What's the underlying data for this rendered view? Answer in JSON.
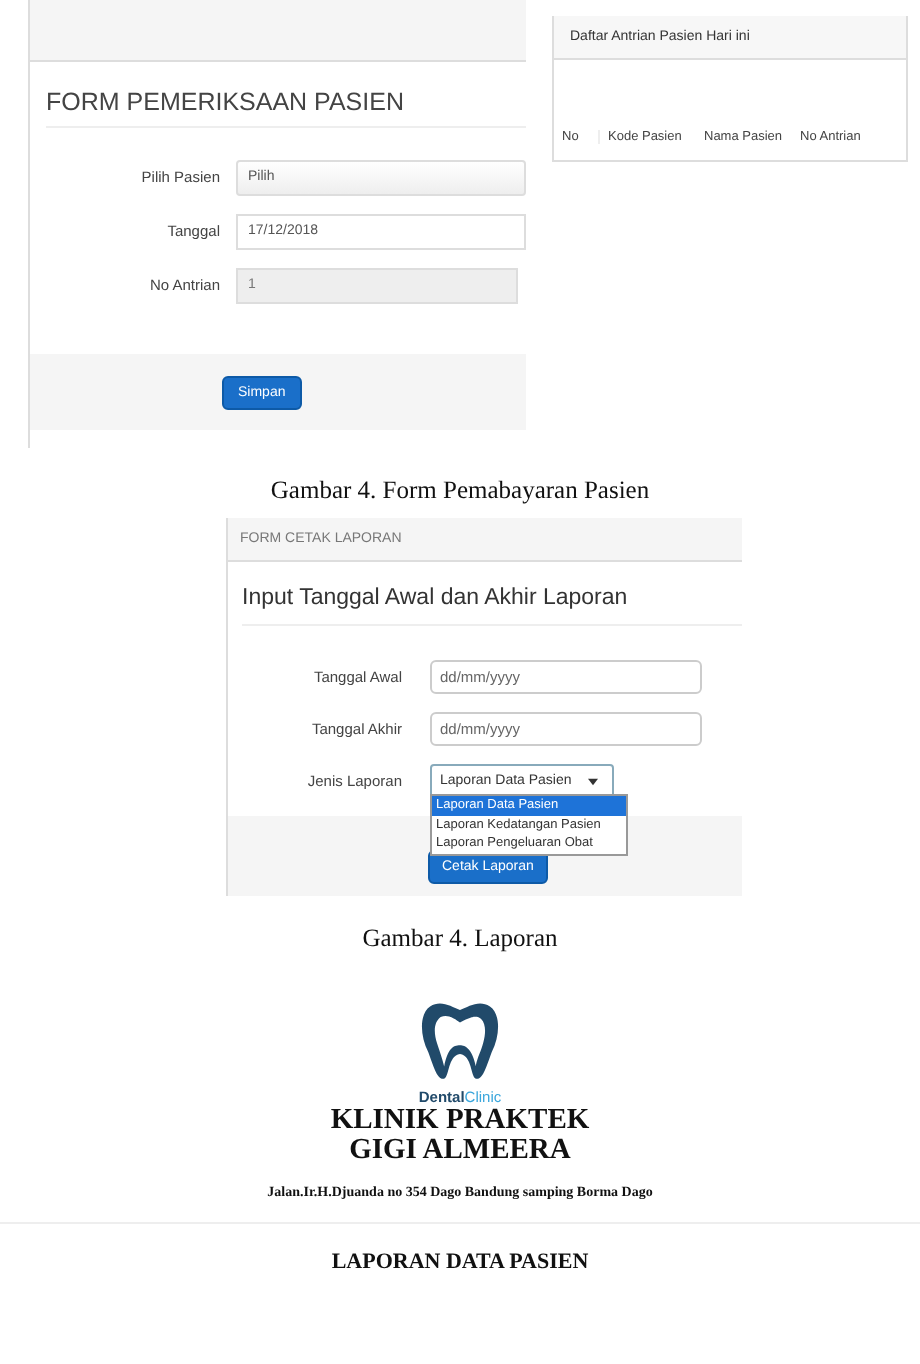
{
  "form_pemeriksaan": {
    "title": "FORM PEMERIKSAAN PASIEN",
    "fields": [
      {
        "label": "Pilih Pasien",
        "value": "Pilih",
        "kind": "select",
        "disabled": false
      },
      {
        "label": "Tanggal",
        "value": "17/12/2018",
        "kind": "text",
        "disabled": false
      },
      {
        "label": "No Antrian",
        "value": "1",
        "kind": "text",
        "disabled": true
      }
    ],
    "button": "Simpan"
  },
  "antrian_panel": {
    "title": "Daftar Antrian Pasien Hari ini",
    "columns": [
      "No",
      "Kode Pasien",
      "Nama Pasien",
      "No Antrian"
    ]
  },
  "caption_1": "Gambar 4. Form Pemabayaran Pasien",
  "form_laporan": {
    "header": "FORM CETAK LAPORAN",
    "title": "Input Tanggal Awal dan Akhir Laporan",
    "fields": [
      {
        "label": "Tanggal Awal",
        "placeholder": "dd/mm/yyyy"
      },
      {
        "label": "Tanggal Akhir",
        "placeholder": "dd/mm/yyyy"
      }
    ],
    "select": {
      "label": "Jenis Laporan",
      "value": "Laporan Data Pasien",
      "options": [
        {
          "label": "Laporan Data Pasien",
          "selected": true
        },
        {
          "label": "Laporan Kedatangan Pasien",
          "selected": false
        },
        {
          "label": "Laporan Pengeluaran Obat",
          "selected": false
        }
      ]
    },
    "button": "Cetak Laporan"
  },
  "caption_2": "Gambar 4. Laporan",
  "report": {
    "logo_text": [
      "Dental",
      "Clinic"
    ],
    "clinic_name": [
      "KLINIK PRAKTEK",
      "GIGI ALMEERA"
    ],
    "address": "Jalan.Ir.H.Djuanda no 354 Dago Bandung samping Borma Dago",
    "heading": "LAPORAN DATA PASIEN"
  }
}
